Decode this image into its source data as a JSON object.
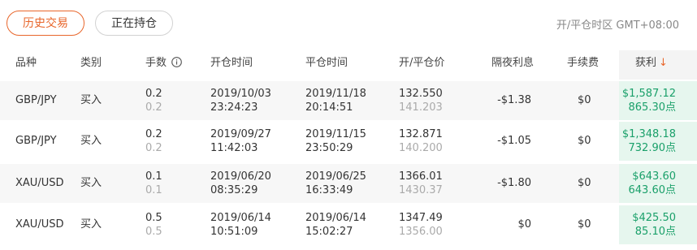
{
  "tabs": {
    "history": "历史交易",
    "open": "正在持仓"
  },
  "timezone": "开/平仓时区 GMT+08:00",
  "columns": {
    "symbol": "品种",
    "type": "类别",
    "lots": "手数",
    "open_time": "开仓时间",
    "close_time": "平仓时间",
    "price": "开/平仓价",
    "swap": "隔夜利息",
    "fee": "手续费",
    "profit": "获利"
  },
  "rows": [
    {
      "symbol": "GBP/JPY",
      "type": "买入",
      "lots": "0.2",
      "lots2": "0.2",
      "open_date": "2019/10/03",
      "open_clock": "23:24:23",
      "close_date": "2019/11/18",
      "close_clock": "20:14:51",
      "open_price": "132.550",
      "close_price": "141.203",
      "swap": "-$1.38",
      "fee": "$0",
      "profit": "$1,587.12",
      "points": "865.30点"
    },
    {
      "symbol": "GBP/JPY",
      "type": "买入",
      "lots": "0.2",
      "lots2": "0.2",
      "open_date": "2019/09/27",
      "open_clock": "11:42:03",
      "close_date": "2019/11/15",
      "close_clock": "23:50:29",
      "open_price": "132.871",
      "close_price": "140.200",
      "swap": "-$1.05",
      "fee": "$0",
      "profit": "$1,348.18",
      "points": "732.90点"
    },
    {
      "symbol": "XAU/USD",
      "type": "买入",
      "lots": "0.1",
      "lots2": "0.1",
      "open_date": "2019/06/20",
      "open_clock": "08:35:29",
      "close_date": "2019/06/25",
      "close_clock": "16:33:49",
      "open_price": "1366.01",
      "close_price": "1430.37",
      "swap": "-$1.80",
      "fee": "$0",
      "profit": "$643.60",
      "points": "643.60点"
    },
    {
      "symbol": "XAU/USD",
      "type": "买入",
      "lots": "0.5",
      "lots2": "0.5",
      "open_date": "2019/06/14",
      "open_clock": "10:51:09",
      "close_date": "2019/06/14",
      "close_clock": "15:02:27",
      "open_price": "1347.49",
      "close_price": "1356.00",
      "swap": "$0",
      "fee": "$0",
      "profit": "$425.50",
      "points": "85.10点"
    }
  ],
  "colors": {
    "accent": "#e8662b",
    "profit": "#1aa06a",
    "profit_bg": "#e6f6ee"
  }
}
